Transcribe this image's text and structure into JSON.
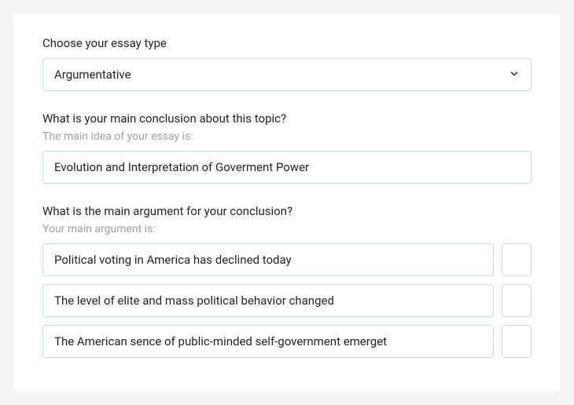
{
  "essay_type": {
    "label": "Choose your essay type",
    "value": "Argumentative"
  },
  "conclusion": {
    "label": "What is your main conclusion about this topic?",
    "sublabel": "The main idea of your essay is:",
    "value": "Evolution and Interpretation of Goverment Power"
  },
  "arguments": {
    "label": "What is the main argument for your conclusion?",
    "sublabel": "Your main argument is:",
    "items": [
      "Political voting in America has declined today",
      "The level of elite and mass political behavior changed",
      "The American sence of public-minded self-government emerget"
    ]
  }
}
